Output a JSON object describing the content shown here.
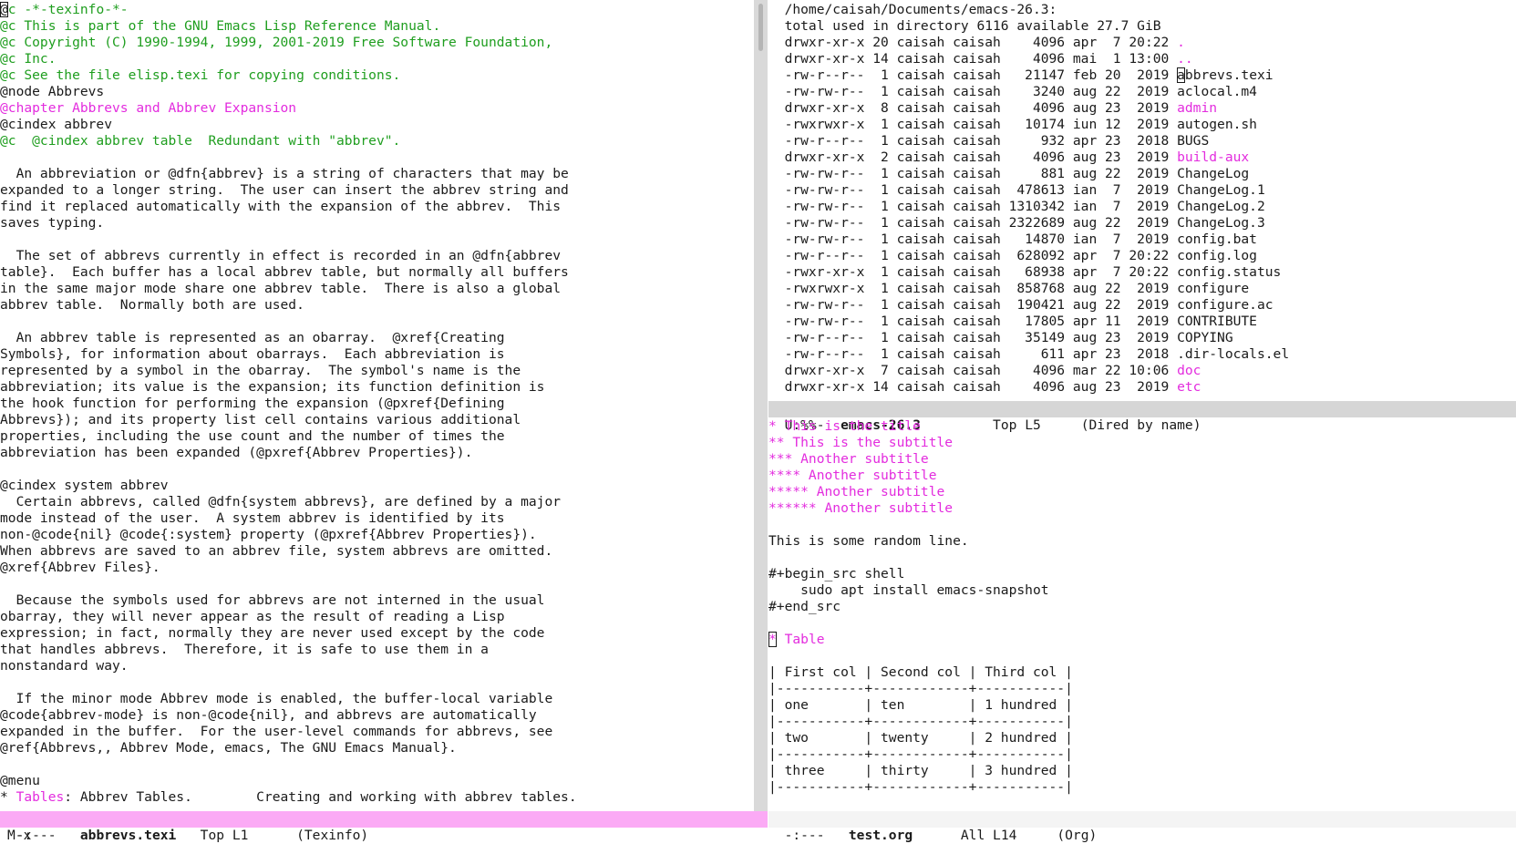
{
  "left": {
    "lines": [
      {
        "segs": [
          {
            "t": "@",
            "c": "cur"
          },
          {
            "t": "c -*-texinfo-*-",
            "c": "cm"
          }
        ]
      },
      {
        "segs": [
          {
            "t": "@c This is part of the GNU Emacs Lisp Reference Manual.",
            "c": "cm"
          }
        ]
      },
      {
        "segs": [
          {
            "t": "@c Copyright (C) 1990-1994, 1999, 2001-2019 Free Software Foundation,",
            "c": "cm"
          }
        ]
      },
      {
        "segs": [
          {
            "t": "@c Inc.",
            "c": "cm"
          }
        ]
      },
      {
        "segs": [
          {
            "t": "@c See the file elisp.texi for copying conditions.",
            "c": "cm"
          }
        ]
      },
      {
        "segs": [
          {
            "t": "@node Abbrevs",
            "c": "k"
          }
        ]
      },
      {
        "segs": [
          {
            "t": "@chapter Abbrevs and Abbrev Expansion",
            "c": "hl"
          }
        ]
      },
      {
        "segs": [
          {
            "t": "@cindex abbrev",
            "c": "k"
          }
        ]
      },
      {
        "segs": [
          {
            "t": "@c  @cindex abbrev table  Redundant with \"abbrev\".",
            "c": "cm"
          }
        ]
      },
      {
        "segs": [
          {
            "t": "",
            "c": "k"
          }
        ]
      },
      {
        "segs": [
          {
            "t": "  An abbreviation or @dfn{abbrev} is a string of characters that may be",
            "c": "k"
          }
        ]
      },
      {
        "segs": [
          {
            "t": "expanded to a longer string.  The user can insert the abbrev string and",
            "c": "k"
          }
        ]
      },
      {
        "segs": [
          {
            "t": "find it replaced automatically with the expansion of the abbrev.  This",
            "c": "k"
          }
        ]
      },
      {
        "segs": [
          {
            "t": "saves typing.",
            "c": "k"
          }
        ]
      },
      {
        "segs": [
          {
            "t": "",
            "c": "k"
          }
        ]
      },
      {
        "segs": [
          {
            "t": "  The set of abbrevs currently in effect is recorded in an @dfn{abbrev",
            "c": "k"
          }
        ]
      },
      {
        "segs": [
          {
            "t": "table}.  Each buffer has a local abbrev table, but normally all buffers",
            "c": "k"
          }
        ]
      },
      {
        "segs": [
          {
            "t": "in the same major mode share one abbrev table.  There is also a global",
            "c": "k"
          }
        ]
      },
      {
        "segs": [
          {
            "t": "abbrev table.  Normally both are used.",
            "c": "k"
          }
        ]
      },
      {
        "segs": [
          {
            "t": "",
            "c": "k"
          }
        ]
      },
      {
        "segs": [
          {
            "t": "  An abbrev table is represented as an obarray.  @xref{Creating",
            "c": "k"
          }
        ]
      },
      {
        "segs": [
          {
            "t": "Symbols}, for information about obarrays.  Each abbreviation is",
            "c": "k"
          }
        ]
      },
      {
        "segs": [
          {
            "t": "represented by a symbol in the obarray.  The symbol's name is the",
            "c": "k"
          }
        ]
      },
      {
        "segs": [
          {
            "t": "abbreviation; its value is the expansion; its function definition is",
            "c": "k"
          }
        ]
      },
      {
        "segs": [
          {
            "t": "the hook function for performing the expansion (@pxref{Defining",
            "c": "k"
          }
        ]
      },
      {
        "segs": [
          {
            "t": "Abbrevs}); and its property list cell contains various additional",
            "c": "k"
          }
        ]
      },
      {
        "segs": [
          {
            "t": "properties, including the use count and the number of times the",
            "c": "k"
          }
        ]
      },
      {
        "segs": [
          {
            "t": "abbreviation has been expanded (@pxref{Abbrev Properties}).",
            "c": "k"
          }
        ]
      },
      {
        "segs": [
          {
            "t": "",
            "c": "k"
          }
        ]
      },
      {
        "segs": [
          {
            "t": "@cindex system abbrev",
            "c": "k"
          }
        ]
      },
      {
        "segs": [
          {
            "t": "  Certain abbrevs, called @dfn{system abbrevs}, are defined by a major",
            "c": "k"
          }
        ]
      },
      {
        "segs": [
          {
            "t": "mode instead of the user.  A system abbrev is identified by its",
            "c": "k"
          }
        ]
      },
      {
        "segs": [
          {
            "t": "non-@code{nil} @code{:system} property (@pxref{Abbrev Properties}).",
            "c": "k"
          }
        ]
      },
      {
        "segs": [
          {
            "t": "When abbrevs are saved to an abbrev file, system abbrevs are omitted.",
            "c": "k"
          }
        ]
      },
      {
        "segs": [
          {
            "t": "@xref{Abbrev Files}.",
            "c": "k"
          }
        ]
      },
      {
        "segs": [
          {
            "t": "",
            "c": "k"
          }
        ]
      },
      {
        "segs": [
          {
            "t": "  Because the symbols used for abbrevs are not interned in the usual",
            "c": "k"
          }
        ]
      },
      {
        "segs": [
          {
            "t": "obarray, they will never appear as the result of reading a Lisp",
            "c": "k"
          }
        ]
      },
      {
        "segs": [
          {
            "t": "expression; in fact, normally they are never used except by the code",
            "c": "k"
          }
        ]
      },
      {
        "segs": [
          {
            "t": "that handles abbrevs.  Therefore, it is safe to use them in a",
            "c": "k"
          }
        ]
      },
      {
        "segs": [
          {
            "t": "nonstandard way.",
            "c": "k"
          }
        ]
      },
      {
        "segs": [
          {
            "t": "",
            "c": "k"
          }
        ]
      },
      {
        "segs": [
          {
            "t": "  If the minor mode Abbrev mode is enabled, the buffer-local variable",
            "c": "k"
          }
        ]
      },
      {
        "segs": [
          {
            "t": "@code{abbrev-mode} is non-@code{nil}, and abbrevs are automatically",
            "c": "k"
          }
        ]
      },
      {
        "segs": [
          {
            "t": "expanded in the buffer.  For the user-level commands for abbrevs, see",
            "c": "k"
          }
        ]
      },
      {
        "segs": [
          {
            "t": "@ref{Abbrevs,, Abbrev Mode, emacs, The GNU Emacs Manual}.",
            "c": "k"
          }
        ]
      },
      {
        "segs": [
          {
            "t": "",
            "c": "k"
          }
        ]
      },
      {
        "segs": [
          {
            "t": "@menu",
            "c": "k"
          }
        ]
      },
      {
        "segs": [
          {
            "t": "* ",
            "c": "k"
          },
          {
            "t": "Tables",
            "c": "hl"
          },
          {
            "t": ": Abbrev Tables.        Creating and working with abbrev tables.",
            "c": "k"
          }
        ]
      }
    ]
  },
  "dired": {
    "header": "  /home/caisah/Documents/emacs-26.3:",
    "total": "  total used in directory 6116 available 27.7 GiB",
    "rows": [
      {
        "perm": "drwxr-xr-x",
        "n": "20",
        "u": "caisah",
        "g": "caisah",
        "size": "4096",
        "date": "apr  7 20:22",
        "name": ".",
        "dir": true
      },
      {
        "perm": "drwxr-xr-x",
        "n": "14",
        "u": "caisah",
        "g": "caisah",
        "size": "4096",
        "date": "mai  1 13:00",
        "name": "..",
        "dir": true
      },
      {
        "perm": "-rw-r--r--",
        "n": "1",
        "u": "caisah",
        "g": "caisah",
        "size": "21147",
        "date": "feb 20  2019",
        "name": "abbrevs.texi",
        "dir": false,
        "cursor": true
      },
      {
        "perm": "-rw-rw-r--",
        "n": "1",
        "u": "caisah",
        "g": "caisah",
        "size": "3240",
        "date": "aug 22  2019",
        "name": "aclocal.m4",
        "dir": false
      },
      {
        "perm": "drwxr-xr-x",
        "n": "8",
        "u": "caisah",
        "g": "caisah",
        "size": "4096",
        "date": "aug 23  2019",
        "name": "admin",
        "dir": true
      },
      {
        "perm": "-rwxrwxr-x",
        "n": "1",
        "u": "caisah",
        "g": "caisah",
        "size": "10174",
        "date": "iun 12  2019",
        "name": "autogen.sh",
        "dir": false
      },
      {
        "perm": "-rw-r--r--",
        "n": "1",
        "u": "caisah",
        "g": "caisah",
        "size": "932",
        "date": "apr 23  2018",
        "name": "BUGS",
        "dir": false
      },
      {
        "perm": "drwxr-xr-x",
        "n": "2",
        "u": "caisah",
        "g": "caisah",
        "size": "4096",
        "date": "aug 23  2019",
        "name": "build-aux",
        "dir": true
      },
      {
        "perm": "-rw-rw-r--",
        "n": "1",
        "u": "caisah",
        "g": "caisah",
        "size": "881",
        "date": "aug 22  2019",
        "name": "ChangeLog",
        "dir": false
      },
      {
        "perm": "-rw-rw-r--",
        "n": "1",
        "u": "caisah",
        "g": "caisah",
        "size": "478613",
        "date": "ian  7  2019",
        "name": "ChangeLog.1",
        "dir": false
      },
      {
        "perm": "-rw-rw-r--",
        "n": "1",
        "u": "caisah",
        "g": "caisah",
        "size": "1310342",
        "date": "ian  7  2019",
        "name": "ChangeLog.2",
        "dir": false
      },
      {
        "perm": "-rw-rw-r--",
        "n": "1",
        "u": "caisah",
        "g": "caisah",
        "size": "2322689",
        "date": "aug 22  2019",
        "name": "ChangeLog.3",
        "dir": false
      },
      {
        "perm": "-rw-rw-r--",
        "n": "1",
        "u": "caisah",
        "g": "caisah",
        "size": "14870",
        "date": "ian  7  2019",
        "name": "config.bat",
        "dir": false
      },
      {
        "perm": "-rw-r--r--",
        "n": "1",
        "u": "caisah",
        "g": "caisah",
        "size": "628092",
        "date": "apr  7 20:22",
        "name": "config.log",
        "dir": false
      },
      {
        "perm": "-rwxr-xr-x",
        "n": "1",
        "u": "caisah",
        "g": "caisah",
        "size": "68938",
        "date": "apr  7 20:22",
        "name": "config.status",
        "dir": false
      },
      {
        "perm": "-rwxrwxr-x",
        "n": "1",
        "u": "caisah",
        "g": "caisah",
        "size": "858768",
        "date": "aug 22  2019",
        "name": "configure",
        "dir": false
      },
      {
        "perm": "-rw-rw-r--",
        "n": "1",
        "u": "caisah",
        "g": "caisah",
        "size": "190421",
        "date": "aug 22  2019",
        "name": "configure.ac",
        "dir": false
      },
      {
        "perm": "-rw-rw-r--",
        "n": "1",
        "u": "caisah",
        "g": "caisah",
        "size": "17805",
        "date": "apr 11  2019",
        "name": "CONTRIBUTE",
        "dir": false
      },
      {
        "perm": "-rw-r--r--",
        "n": "1",
        "u": "caisah",
        "g": "caisah",
        "size": "35149",
        "date": "aug 23  2019",
        "name": "COPYING",
        "dir": false
      },
      {
        "perm": "-rw-r--r--",
        "n": "1",
        "u": "caisah",
        "g": "caisah",
        "size": "611",
        "date": "apr 23  2018",
        "name": ".dir-locals.el",
        "dir": false
      },
      {
        "perm": "drwxr-xr-x",
        "n": "7",
        "u": "caisah",
        "g": "caisah",
        "size": "4096",
        "date": "mar 22 10:06",
        "name": "doc",
        "dir": true
      },
      {
        "perm": "drwxr-xr-x",
        "n": "14",
        "u": "caisah",
        "g": "caisah",
        "size": "4096",
        "date": "aug 23  2019",
        "name": "etc",
        "dir": true
      }
    ],
    "modeline": {
      "status": "U:%%-",
      "buffer": "emacs-26.3",
      "pos": "Top L5",
      "mode": "(Dired by name)"
    }
  },
  "org": {
    "headings": [
      "* This is the title",
      "** This is the subtitle",
      "*** Another subtitle",
      "**** Another subtitle",
      "***** Another subtitle",
      "****** Another subtitle"
    ],
    "random_line": "This is some random line.",
    "src_begin": "#+begin_src shell",
    "src_body": "    sudo apt install emacs-snapshot",
    "src_end": "#+end_src",
    "table_heading_star": "*",
    "table_heading_text": " Table",
    "table_rows": [
      "| First col | Second col | Third col |",
      "|-----------+------------+-----------|",
      "| one       | ten        | 1 hundred |",
      "|-----------+------------+-----------|",
      "| two       | twenty     | 2 hundred |",
      "|-----------+------------+-----------|",
      "| three     | thirty     | 3 hundred |",
      "|-----------+------------+-----------|"
    ],
    "modeline": {
      "status": "-:---",
      "buffer": "test.org",
      "pos": "All L14",
      "mode": "(Org)"
    }
  },
  "left_modeline": {
    "status": "-:---",
    "buffer": "abbrevs.texi",
    "pos": "Top L1",
    "mode": "(Texinfo)"
  },
  "minibuffer": "M-x"
}
